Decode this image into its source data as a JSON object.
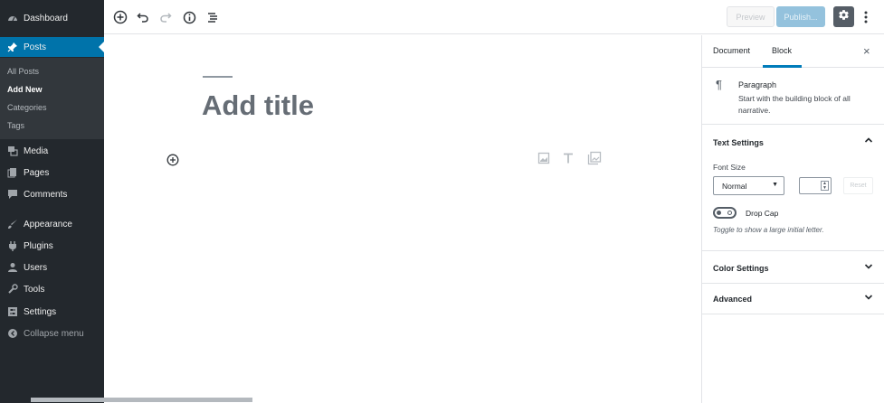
{
  "sidebar": {
    "items": [
      {
        "label": "Dashboard",
        "icon": "dashboard-icon"
      },
      {
        "label": "Posts",
        "icon": "pin-icon"
      },
      {
        "label": "Media",
        "icon": "media-icon"
      },
      {
        "label": "Pages",
        "icon": "pages-icon"
      },
      {
        "label": "Comments",
        "icon": "comments-icon"
      },
      {
        "label": "Appearance",
        "icon": "appearance-icon"
      },
      {
        "label": "Plugins",
        "icon": "plugins-icon"
      },
      {
        "label": "Users",
        "icon": "users-icon"
      },
      {
        "label": "Tools",
        "icon": "tools-icon"
      },
      {
        "label": "Settings",
        "icon": "settings-icon"
      },
      {
        "label": "Collapse menu",
        "icon": "collapse-icon"
      }
    ],
    "active_item": "Posts",
    "posts_submenu": [
      "All Posts",
      "Add New",
      "Categories",
      "Tags"
    ],
    "current_subitem": "Add New"
  },
  "toolbar": {
    "preview_label": "Preview",
    "publish_label": "Publish..."
  },
  "editor": {
    "title_placeholder": "Add title"
  },
  "panel": {
    "tabs": [
      "Document",
      "Block"
    ],
    "active_tab": "Block",
    "close_symbol": "×",
    "block_card": {
      "title": "Paragraph",
      "description": "Start with the building block of all narrative."
    },
    "text_settings": {
      "heading": "Text Settings",
      "font_size_label": "Font Size",
      "font_size_value": "Normal",
      "reset_label": "Reset",
      "drop_cap_label": "Drop Cap",
      "drop_cap_help": "Toggle to show a large initial letter."
    },
    "color_settings_heading": "Color Settings",
    "advanced_heading": "Advanced"
  },
  "colors": {
    "sidebar_bg": "#23282d",
    "accent": "#0073aa",
    "publish_disabled": "#94c2dd"
  }
}
